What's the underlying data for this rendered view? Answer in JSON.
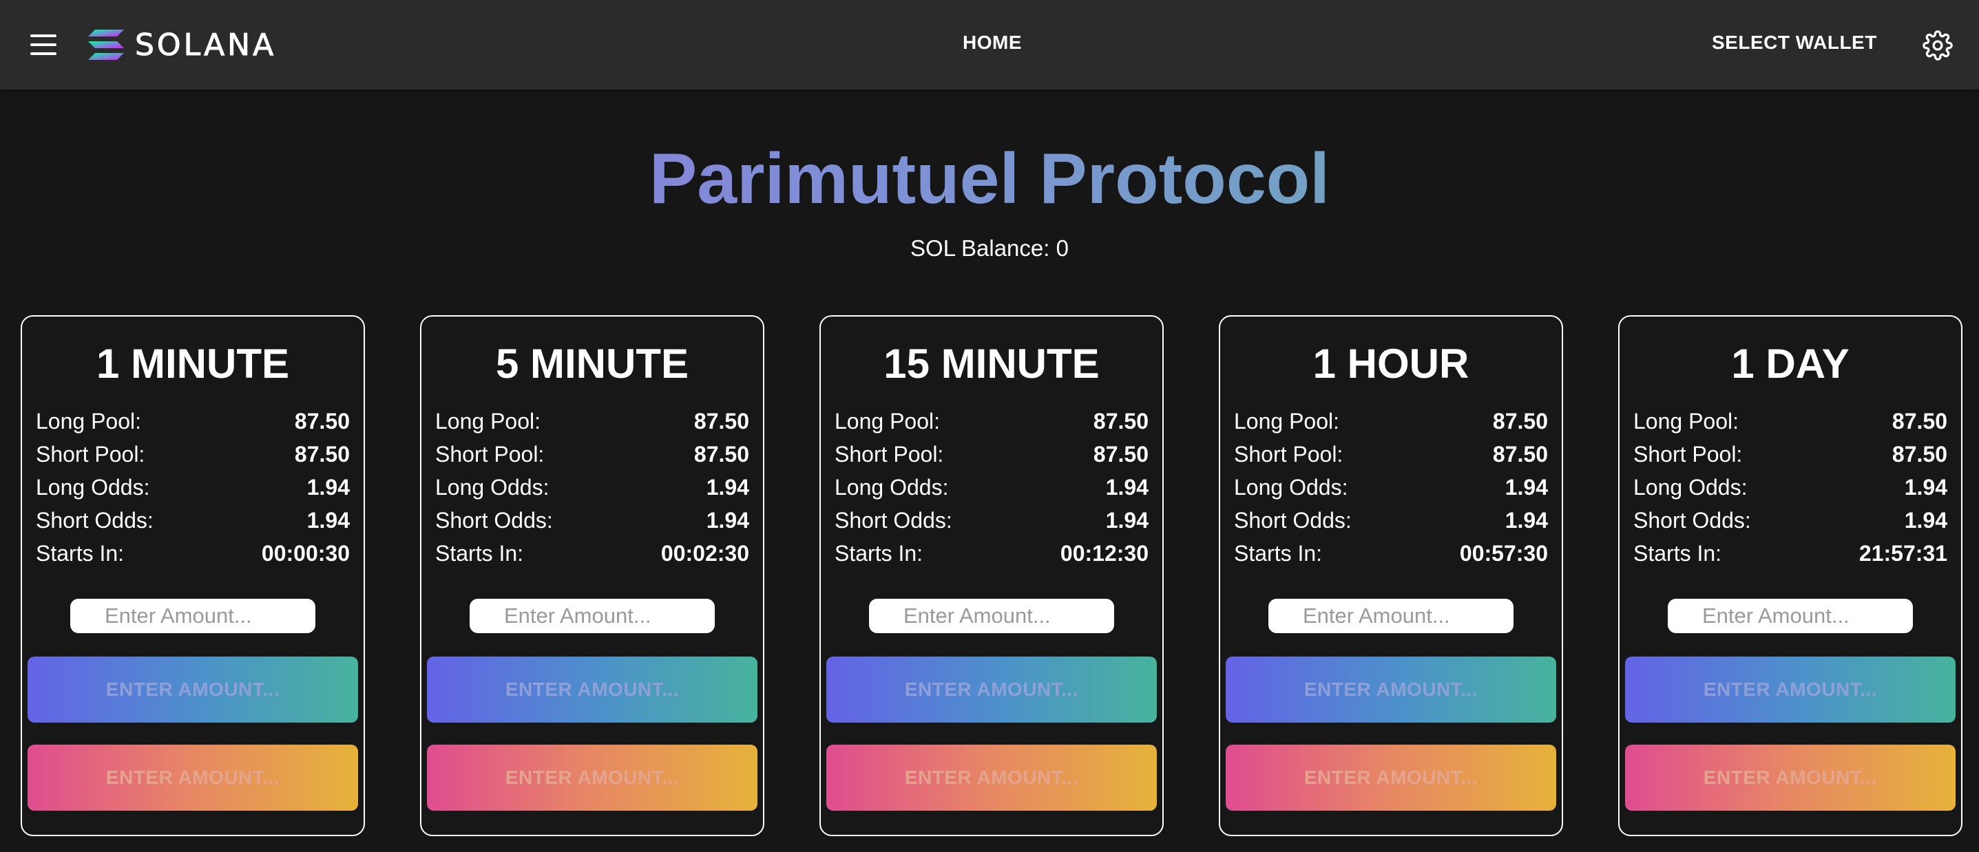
{
  "header": {
    "brand": "SOLANA",
    "nav_home": "HOME",
    "select_wallet": "SELECT WALLET",
    "menu_icon": "hamburger-menu-icon",
    "settings_icon": "gear-icon"
  },
  "main": {
    "title": "Parimutuel Protocol",
    "balance": "SOL Balance: 0"
  },
  "colors": {
    "background": "#161616",
    "header": "#2b2b2b",
    "title_gradient": [
      "#8f6bdb",
      "#5fb9a8"
    ],
    "long_gradient": [
      "#6463e6",
      "#48b39c"
    ],
    "short_gradient": [
      "#df4d90",
      "#e6b23a"
    ]
  },
  "labels": {
    "long_pool": "Long Pool:",
    "short_pool": "Short Pool:",
    "long_odds": "Long Odds:",
    "short_odds": "Short Odds:",
    "starts_in": "Starts In:",
    "input_placeholder": "Enter Amount...",
    "button_text": "ENTER AMOUNT..."
  },
  "markets": [
    {
      "title": "1 MINUTE",
      "long_pool": "87.50",
      "short_pool": "87.50",
      "long_odds": "1.94",
      "short_odds": "1.94",
      "starts_in": "00:00:30"
    },
    {
      "title": "5 MINUTE",
      "long_pool": "87.50",
      "short_pool": "87.50",
      "long_odds": "1.94",
      "short_odds": "1.94",
      "starts_in": "00:02:30"
    },
    {
      "title": "15 MINUTE",
      "long_pool": "87.50",
      "short_pool": "87.50",
      "long_odds": "1.94",
      "short_odds": "1.94",
      "starts_in": "00:12:30"
    },
    {
      "title": "1 HOUR",
      "long_pool": "87.50",
      "short_pool": "87.50",
      "long_odds": "1.94",
      "short_odds": "1.94",
      "starts_in": "00:57:30"
    },
    {
      "title": "1 DAY",
      "long_pool": "87.50",
      "short_pool": "87.50",
      "long_odds": "1.94",
      "short_odds": "1.94",
      "starts_in": "21:57:31"
    }
  ]
}
